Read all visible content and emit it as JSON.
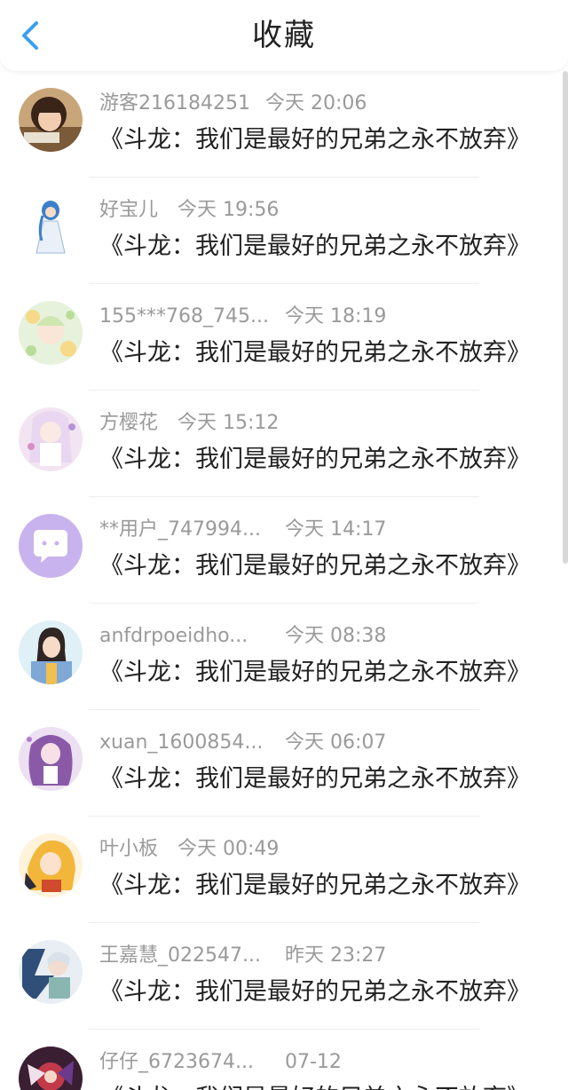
{
  "header": {
    "title": "收藏",
    "back_icon": "chevron-left-icon",
    "accent": "#3aa0f0"
  },
  "items": [
    {
      "user": "游客216184251",
      "time": "今天 20:06",
      "work": "《斗龙：我们是最好的兄弟之永不放弃》"
    },
    {
      "user": "好宝儿",
      "time": "今天 19:56",
      "work": "《斗龙：我们是最好的兄弟之永不放弃》"
    },
    {
      "user": "155***768_745...",
      "time": "今天 18:19",
      "work": "《斗龙：我们是最好的兄弟之永不放弃》"
    },
    {
      "user": "方樱花",
      "time": "今天 15:12",
      "work": "《斗龙：我们是最好的兄弟之永不放弃》"
    },
    {
      "user": "**用户_747994...",
      "time": "今天 14:17",
      "work": "《斗龙：我们是最好的兄弟之永不放弃》"
    },
    {
      "user": "anfdrpoeidho...",
      "time": "今天 08:38",
      "work": "《斗龙：我们是最好的兄弟之永不放弃》"
    },
    {
      "user": "xuan_1600854...",
      "time": "今天 06:07",
      "work": "《斗龙：我们是最好的兄弟之永不放弃》"
    },
    {
      "user": "叶小板",
      "time": "今天 00:49",
      "work": "《斗龙：我们是最好的兄弟之永不放弃》"
    },
    {
      "user": "王嘉慧_022547...",
      "time": "昨天 23:27",
      "work": "《斗龙：我们是最好的兄弟之永不放弃》"
    },
    {
      "user": "仔仔_6723674...",
      "time": "07-12",
      "work": "《斗龙：我们是最好的兄弟之永不放弃》"
    }
  ]
}
